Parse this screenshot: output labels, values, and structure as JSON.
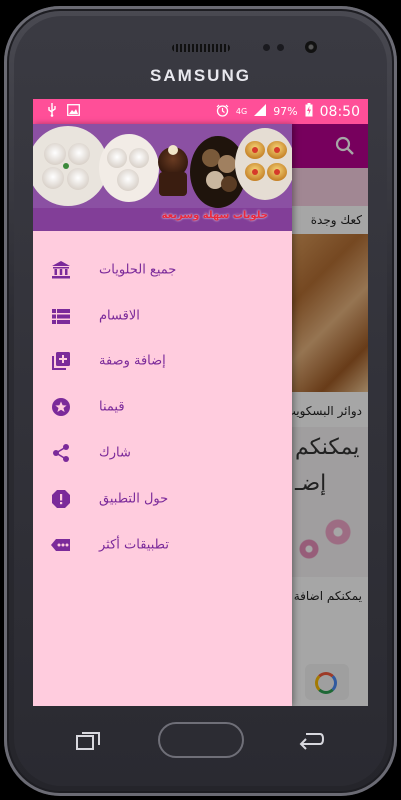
{
  "device": {
    "brand": "SAMSUNG"
  },
  "statusbar": {
    "time": "08:50",
    "battery": "97%",
    "network": "4G",
    "colors": {
      "bar": "#ff4f98"
    },
    "icons": [
      "usb-icon",
      "image-icon",
      "alarm-icon",
      "signal-icon",
      "battery-icon"
    ]
  },
  "app": {
    "appbar_color": "#b7008f",
    "search_icon": "search-icon",
    "cards": [
      {
        "title": "كعك وجدة"
      },
      {
        "title": "دوائر البسكويت"
      },
      {
        "title": "يمكنكم اضافة"
      }
    ],
    "card_overlay_text_1": "يمكنكم",
    "card_overlay_text_2": "إضـ"
  },
  "drawer": {
    "background": "#ffccde",
    "accent": "#7b2a9a",
    "header_caption": "حلويات سهلة وسريعة",
    "items": [
      {
        "label": "جميع الحلويات",
        "icon": "bank-icon"
      },
      {
        "label": "الاقسام",
        "icon": "list-icon"
      },
      {
        "label": "إضافة وصفة",
        "icon": "add-box-icon"
      },
      {
        "label": "قيمنا",
        "icon": "star-icon"
      },
      {
        "label": "شارك",
        "icon": "share-icon"
      },
      {
        "label": "حول التطبيق",
        "icon": "info-icon"
      },
      {
        "label": "تطبيقات أكثر",
        "icon": "more-icon"
      }
    ]
  },
  "navbar": {
    "icons": [
      "recent-apps-icon",
      "home-button",
      "back-icon"
    ]
  }
}
